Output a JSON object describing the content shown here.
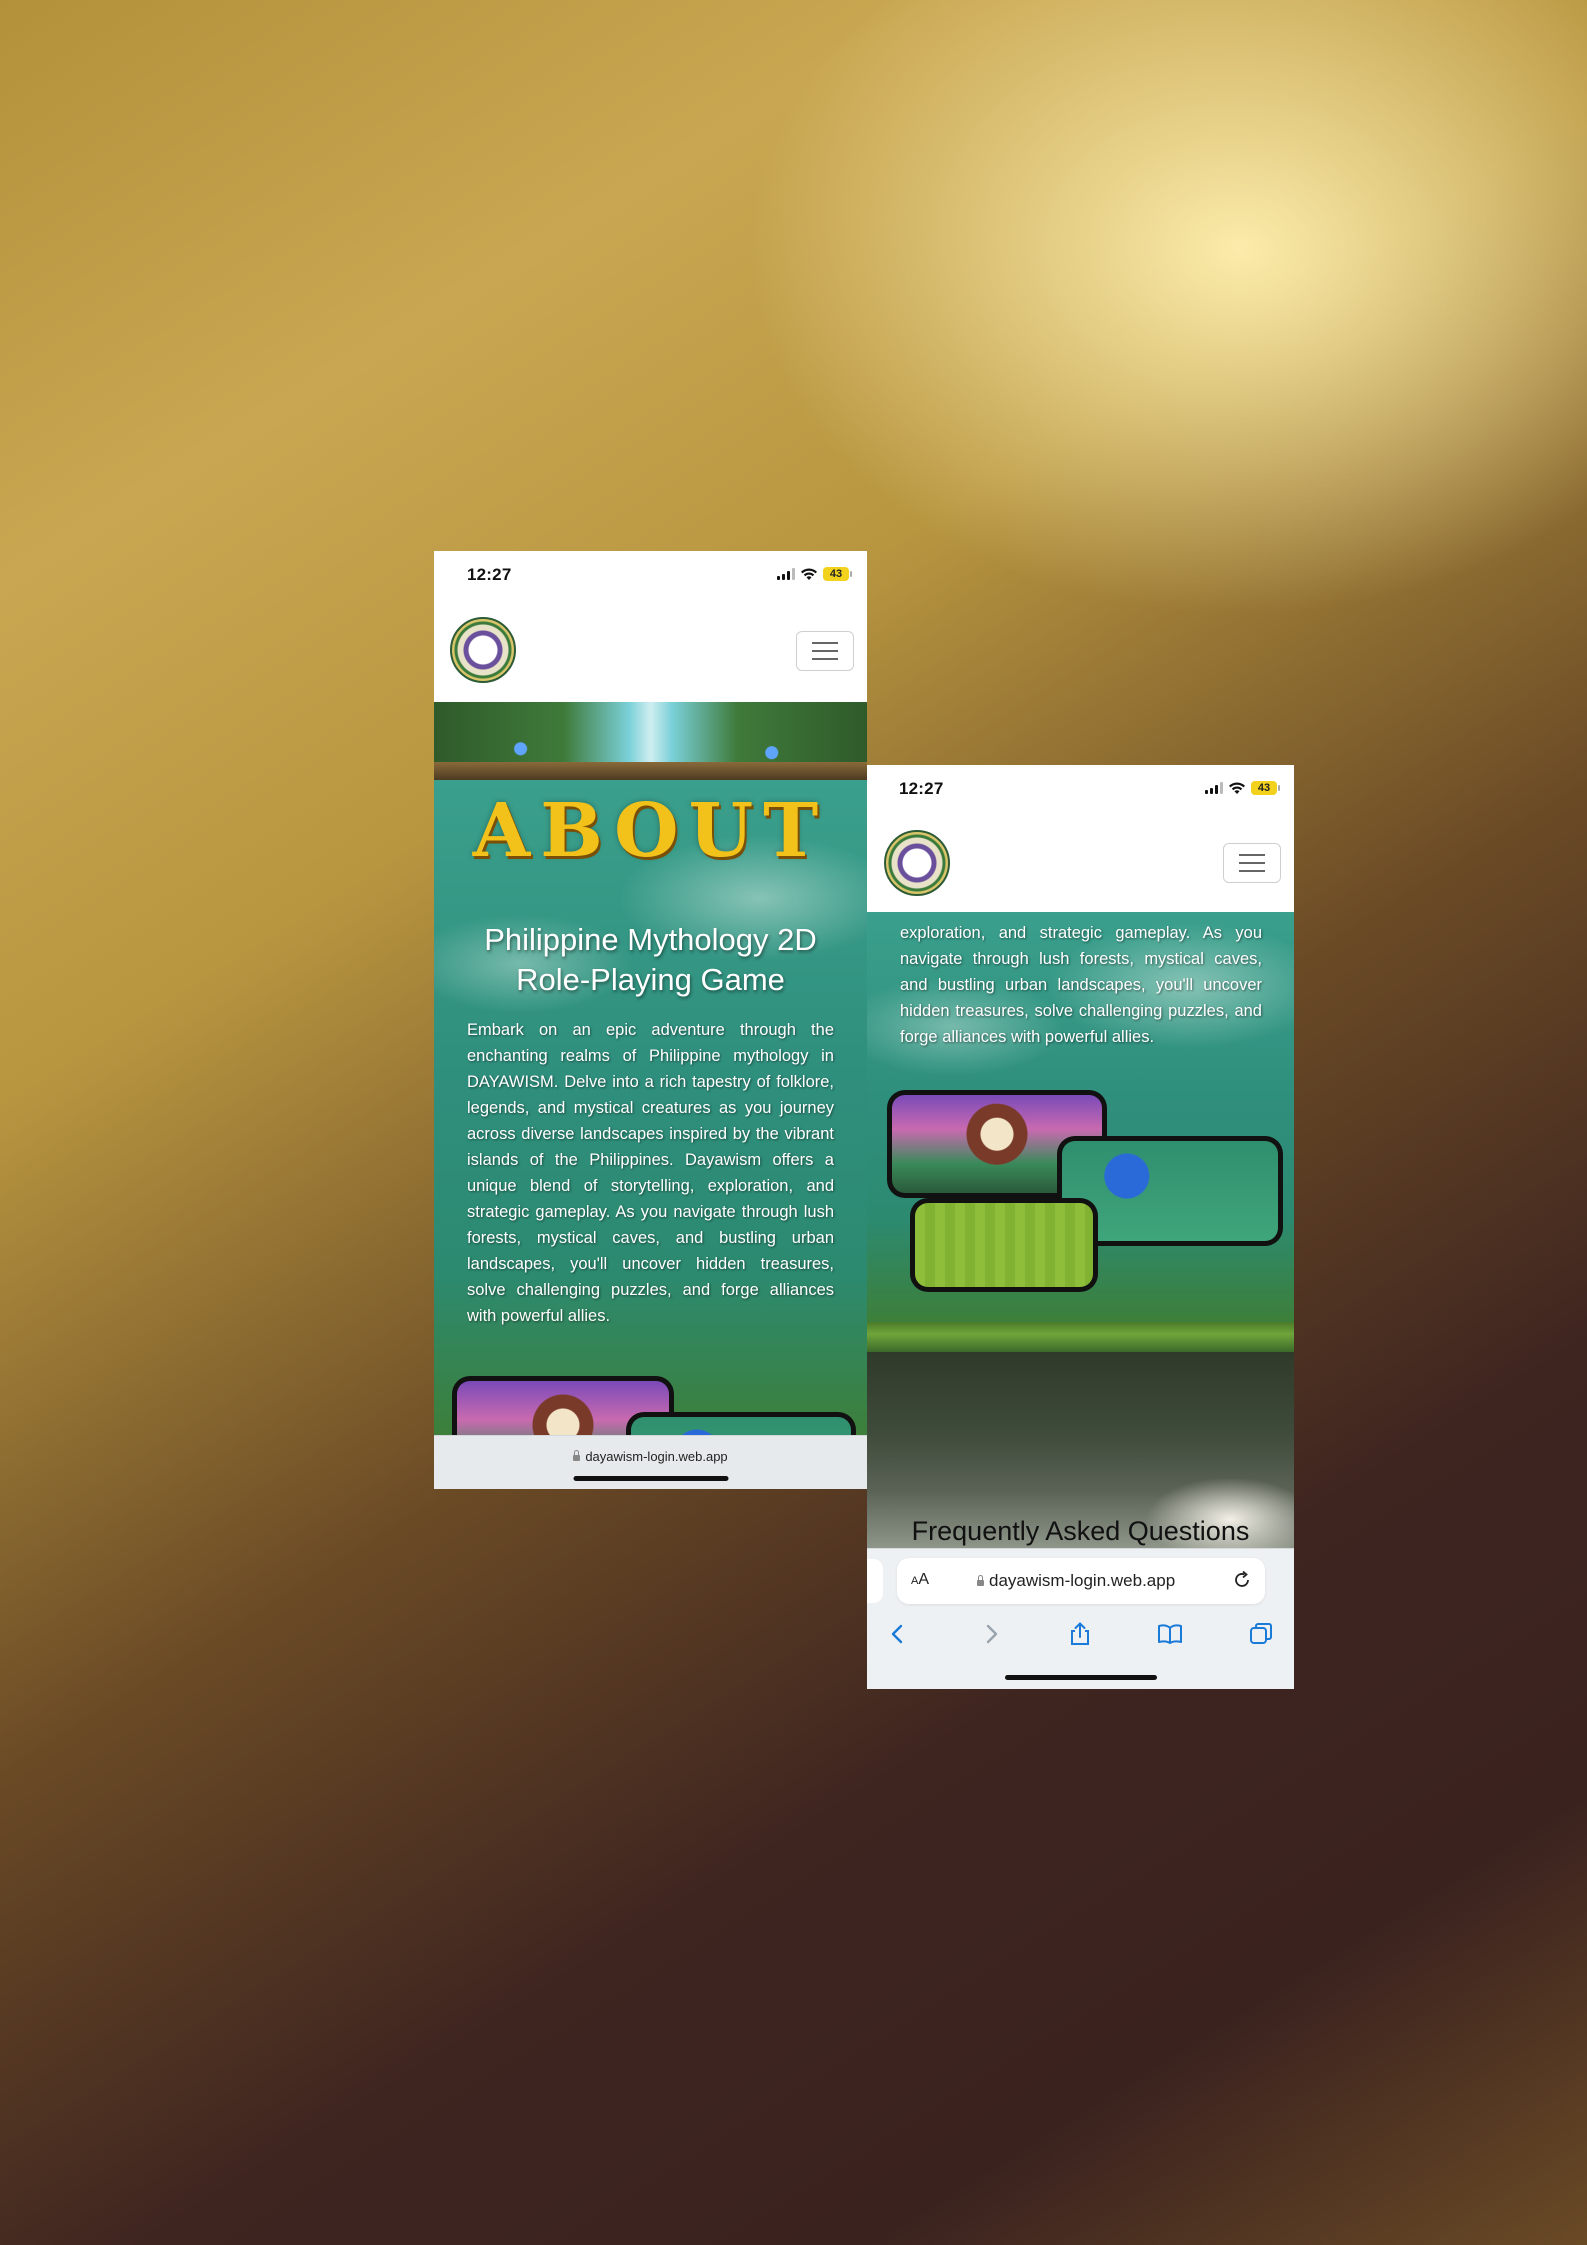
{
  "phone_left": {
    "status": {
      "time": "12:27",
      "battery": "43"
    },
    "about_title": "ABOUT",
    "subtitle": "Philippine Mythology 2D Role-Playing Game",
    "description": "Embark on an epic adventure through the enchanting realms of Philippine mythology in DAYAWISM. Delve into a rich tapestry of folklore, legends, and mystical creatures as you journey across diverse landscapes inspired by the vibrant islands of the Philippines. Dayawism offers a unique blend of storytelling, exploration, and strategic gameplay. As you navigate through lush forests, mystical caves, and bustling urban landscapes, you'll uncover hidden treasures, solve challenging puzzles, and forge alliances with powerful allies.",
    "url": "dayawism-login.web.app"
  },
  "phone_right": {
    "status": {
      "time": "12:27",
      "battery": "43"
    },
    "description_tail": "exploration, and strategic gameplay. As you navigate through lush forests, mystical caves, and bustling urban landscapes, you'll uncover hidden treasures, solve challenging puzzles, and forge alliances with powerful allies.",
    "faq_heading": "Frequently Asked Questions",
    "address_bar": {
      "aa_label": "AA",
      "url": "dayawism-login.web.app"
    },
    "toolbar_icons": [
      "back-icon",
      "forward-icon",
      "share-icon",
      "bookmarks-icon",
      "tabs-icon"
    ]
  },
  "colors": {
    "about_gold": "#f2c21a",
    "panel_teal": "#2f8f7d",
    "safari_blue": "#1a7ad8"
  }
}
